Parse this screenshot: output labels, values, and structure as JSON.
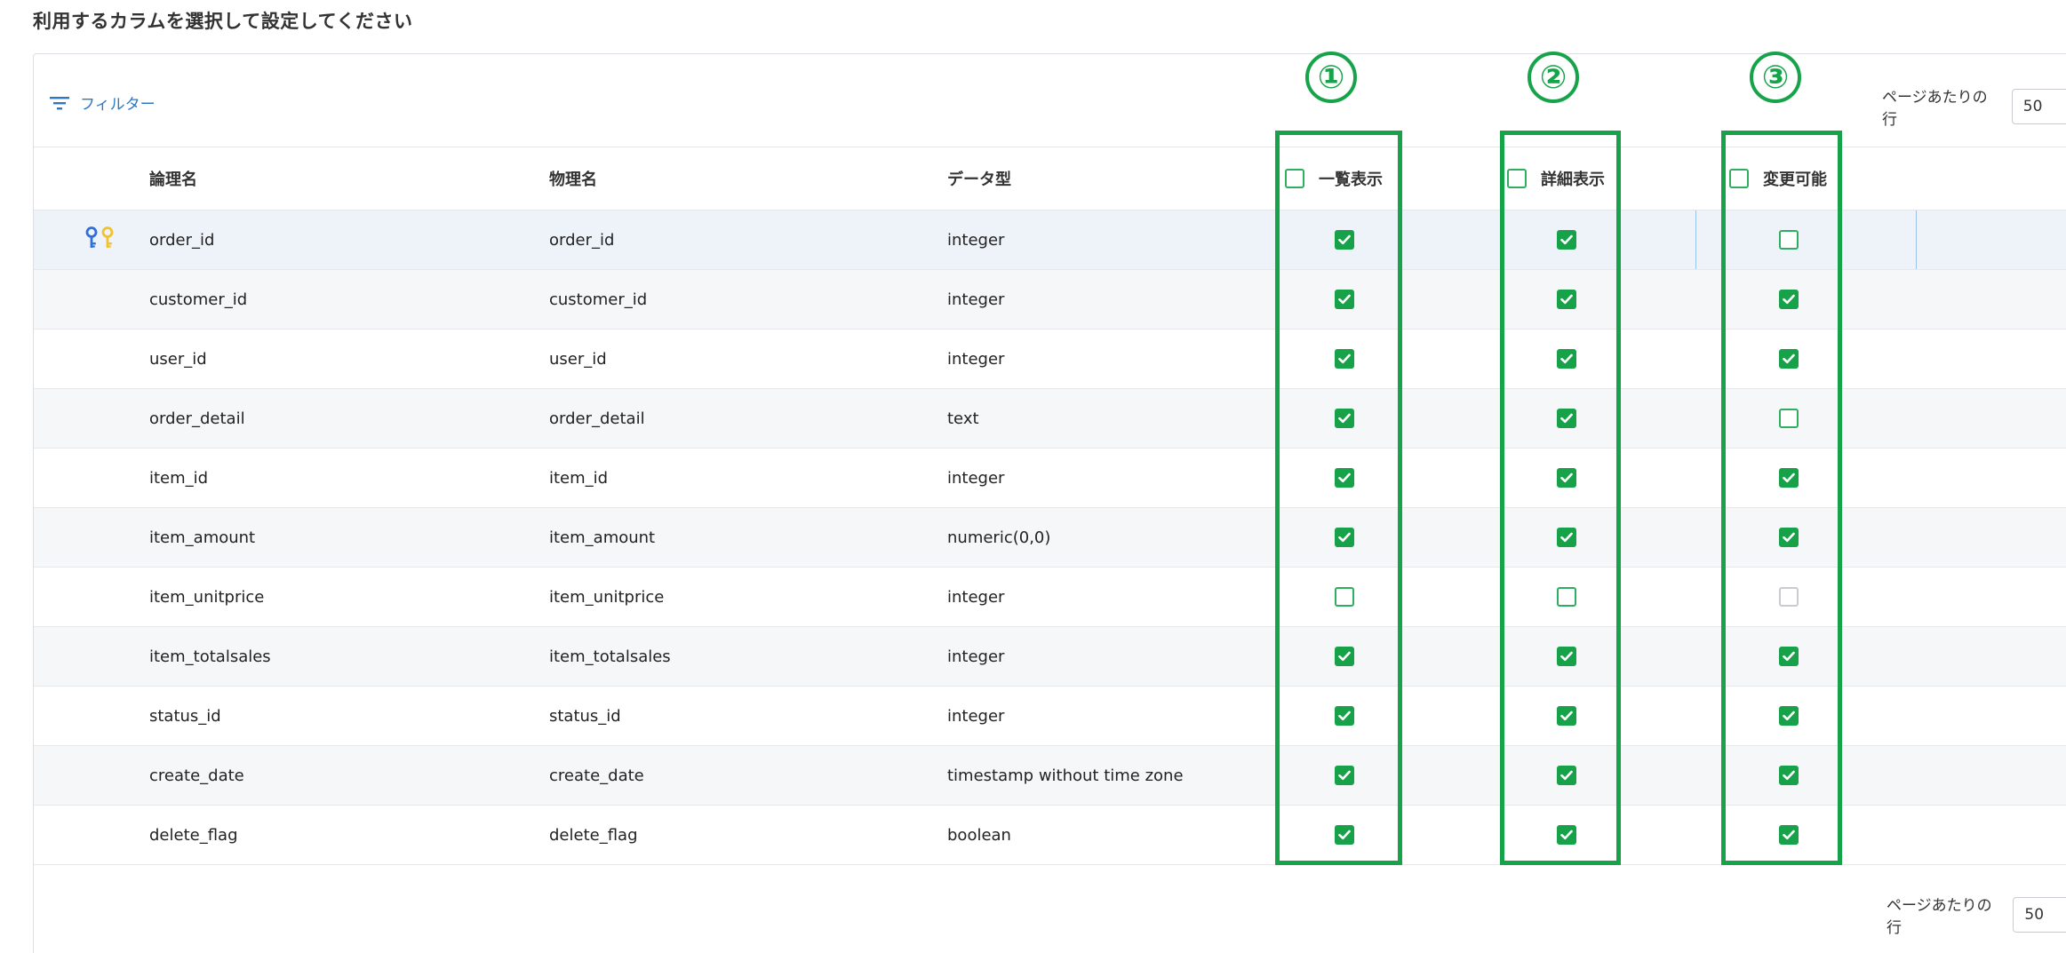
{
  "page_title": "利用するカラムを選択して設定してください",
  "toolbar": {
    "filter_label": "フィルター",
    "rows_per_page_label": "ページあたりの行",
    "rows_per_page_value": "50"
  },
  "footer": {
    "rows_per_page_label": "ページあたりの行",
    "rows_per_page_value": "50"
  },
  "table": {
    "headers": {
      "logical_name": "論理名",
      "physical_name": "物理名",
      "data_type": "データ型",
      "list_display": "一覧表示",
      "detail_display": "詳細表示",
      "editable": "変更可能"
    },
    "rows": [
      {
        "logical": "order_id",
        "physical": "order_id",
        "type": "integer",
        "list": "checked",
        "detail": "checked",
        "edit": "unchecked",
        "keys": true
      },
      {
        "logical": "customer_id",
        "physical": "customer_id",
        "type": "integer",
        "list": "checked",
        "detail": "checked",
        "edit": "checked",
        "keys": false
      },
      {
        "logical": "user_id",
        "physical": "user_id",
        "type": "integer",
        "list": "checked",
        "detail": "checked",
        "edit": "checked",
        "keys": false
      },
      {
        "logical": "order_detail",
        "physical": "order_detail",
        "type": "text",
        "list": "checked",
        "detail": "checked",
        "edit": "unchecked",
        "keys": false
      },
      {
        "logical": "item_id",
        "physical": "item_id",
        "type": "integer",
        "list": "checked",
        "detail": "checked",
        "edit": "checked",
        "keys": false
      },
      {
        "logical": "item_amount",
        "physical": "item_amount",
        "type": "numeric(0,0)",
        "list": "checked",
        "detail": "checked",
        "edit": "checked",
        "keys": false
      },
      {
        "logical": "item_unitprice",
        "physical": "item_unitprice",
        "type": "integer",
        "list": "unchecked",
        "detail": "unchecked",
        "edit": "disabled",
        "keys": false
      },
      {
        "logical": "item_totalsales",
        "physical": "item_totalsales",
        "type": "integer",
        "list": "checked",
        "detail": "checked",
        "edit": "checked",
        "keys": false
      },
      {
        "logical": "status_id",
        "physical": "status_id",
        "type": "integer",
        "list": "checked",
        "detail": "checked",
        "edit": "checked",
        "keys": false
      },
      {
        "logical": "create_date",
        "physical": "create_date",
        "type": "timestamp without time zone",
        "list": "checked",
        "detail": "checked",
        "edit": "checked",
        "keys": false
      },
      {
        "logical": "delete_flag",
        "physical": "delete_flag",
        "type": "boolean",
        "list": "checked",
        "detail": "checked",
        "edit": "checked",
        "keys": false
      }
    ]
  },
  "annotations": {
    "col1_marker": "①",
    "col2_marker": "②",
    "col3_marker": "③"
  },
  "colors": {
    "accent_green": "#16a34a",
    "checkbox_green": "#17a24a",
    "link_blue": "#2b78c5",
    "key_blue": "#2f6fd6",
    "key_yellow": "#f2c12e"
  },
  "icons": {
    "filter": "filter-lines-icon",
    "primary_key": "key-icon",
    "check": "check-icon"
  }
}
